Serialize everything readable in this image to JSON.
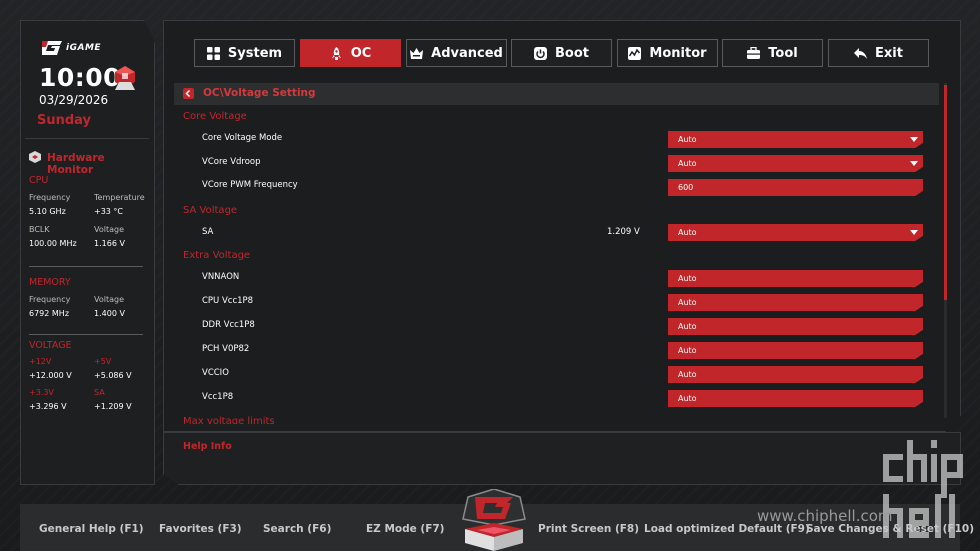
{
  "brand": {
    "logo_text": "iGAME"
  },
  "clock": {
    "time": "10:00",
    "date": "03/29/2026",
    "day": "Sunday"
  },
  "hardware_monitor": {
    "title": "Hardware Monitor",
    "cpu": {
      "heading": "CPU",
      "frequency_label": "Frequency",
      "frequency": "5.10 GHz",
      "temperature_label": "Temperature",
      "temperature": "+33 °C",
      "bclk_label": "BCLK",
      "bclk": "100.00 MHz",
      "voltage_label": "Voltage",
      "voltage": "1.166 V"
    },
    "memory": {
      "heading": "MEMORY",
      "frequency_label": "Frequency",
      "frequency": "6792 MHz",
      "voltage_label": "Voltage",
      "voltage": "1.400 V"
    },
    "voltage": {
      "heading": "VOLTAGE",
      "v12_label": "+12V",
      "v12": "+12.000 V",
      "v5_label": "+5V",
      "v5": "+5.086 V",
      "v33_label": "+3.3V",
      "v33": "+3.296 V",
      "sa_label": "SA",
      "sa": "+1.209 V"
    }
  },
  "tabs": [
    {
      "label": "System"
    },
    {
      "label": "OC"
    },
    {
      "label": "Advanced"
    },
    {
      "label": "Boot"
    },
    {
      "label": "Monitor"
    },
    {
      "label": "Tool"
    },
    {
      "label": "Exit"
    }
  ],
  "breadcrumb": "OC\\Voltage Setting",
  "sections": {
    "core_voltage": {
      "title": "Core Voltage",
      "rows": [
        {
          "label": "Core Voltage Mode",
          "value": "Auto"
        },
        {
          "label": "VCore Vdroop",
          "value": "Auto"
        },
        {
          "label": "VCore PWM Frequency",
          "value": "600"
        }
      ]
    },
    "sa_voltage": {
      "title": "SA Voltage",
      "rows": [
        {
          "label": "SA",
          "reading": "1.209 V",
          "value": "Auto"
        }
      ]
    },
    "extra_voltage": {
      "title": "Extra Voltage",
      "rows": [
        {
          "label": "VNNAON",
          "value": "Auto"
        },
        {
          "label": "CPU Vcc1P8",
          "value": "Auto"
        },
        {
          "label": "DDR Vcc1P8",
          "value": "Auto"
        },
        {
          "label": "PCH V0P82",
          "value": "Auto"
        },
        {
          "label": "VCCIO",
          "value": "Auto"
        },
        {
          "label": "Vcc1P8",
          "value": "Auto"
        }
      ]
    },
    "next_title": "Max voltage limits"
  },
  "help": {
    "title": "Help Info"
  },
  "bottom_keys": [
    {
      "label": "General Help (F1)"
    },
    {
      "label": "Favorites (F3)"
    },
    {
      "label": "Search (F6)"
    },
    {
      "label": "EZ Mode (F7)"
    },
    {
      "label": "Print Screen (F8)"
    },
    {
      "label": "Load optimized Default (F9)"
    },
    {
      "label": "Save Changes & Reset (F10)"
    }
  ],
  "watermark": {
    "text": "www.chiphell.com",
    "logo_text": "chip hell"
  },
  "colors": {
    "accent": "#c1262b",
    "background": "#1c1d1f",
    "panel_border": "#3a3b3e"
  }
}
